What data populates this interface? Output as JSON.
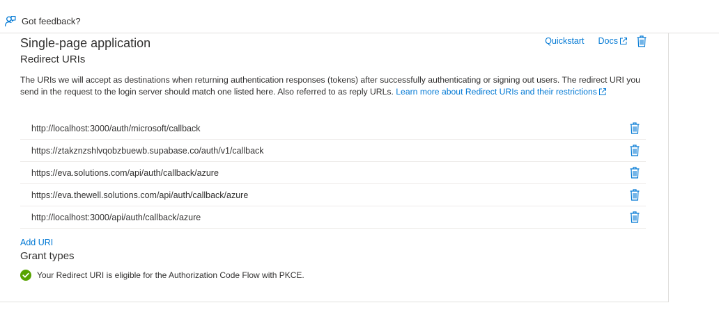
{
  "topbar": {
    "feedback_label": "Got feedback?",
    "feedback_icon": "feedback-person-icon"
  },
  "section": {
    "title": "Single-page application",
    "subtitle": "Redirect URIs",
    "quickstart_label": "Quickstart",
    "docs_label": "Docs",
    "description_text": "The URIs we will accept as destinations when returning authentication responses (tokens) after successfully authenticating or signing out users. The redirect URI you send in the request to the login server should match one listed here. Also referred to as reply URLs.",
    "learn_more_label": "Learn more about Redirect URIs and their restrictions"
  },
  "redirect_uris": [
    "http://localhost:3000/auth/microsoft/callback",
    "https://ztakznzshlvqobzbuewb.supabase.co/auth/v1/callback",
    "https://eva.solutions.com/api/auth/callback/azure",
    "https://eva.thewell.solutions.com/api/auth/callback/azure",
    "http://localhost:3000/api/auth/callback/azure"
  ],
  "add_uri_label": "Add URI",
  "grant_types": {
    "title": "Grant types",
    "status_text": "Your Redirect URI is eligible for the Authorization Code Flow with PKCE."
  },
  "colors": {
    "link": "#0078d4",
    "success": "#57a300",
    "text": "#323130",
    "border": "#e1dfdd"
  }
}
